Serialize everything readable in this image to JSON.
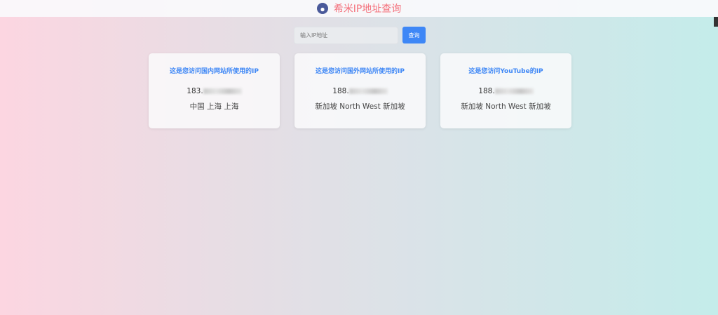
{
  "header": {
    "title": "希米IP地址查询"
  },
  "search": {
    "placeholder": "输入IP地址",
    "button": "查询"
  },
  "cards": [
    {
      "title": "这是您访问国内网站所使用的IP",
      "ip": "183.",
      "location": "中国 上海 上海"
    },
    {
      "title": "这是您访问国外网站所使用的IP",
      "ip": "188.",
      "location": "新加坡 North West 新加坡"
    },
    {
      "title": "这是您访问YouTube的IP",
      "ip": "188.",
      "location": "新加坡 North West 新加坡"
    }
  ]
}
